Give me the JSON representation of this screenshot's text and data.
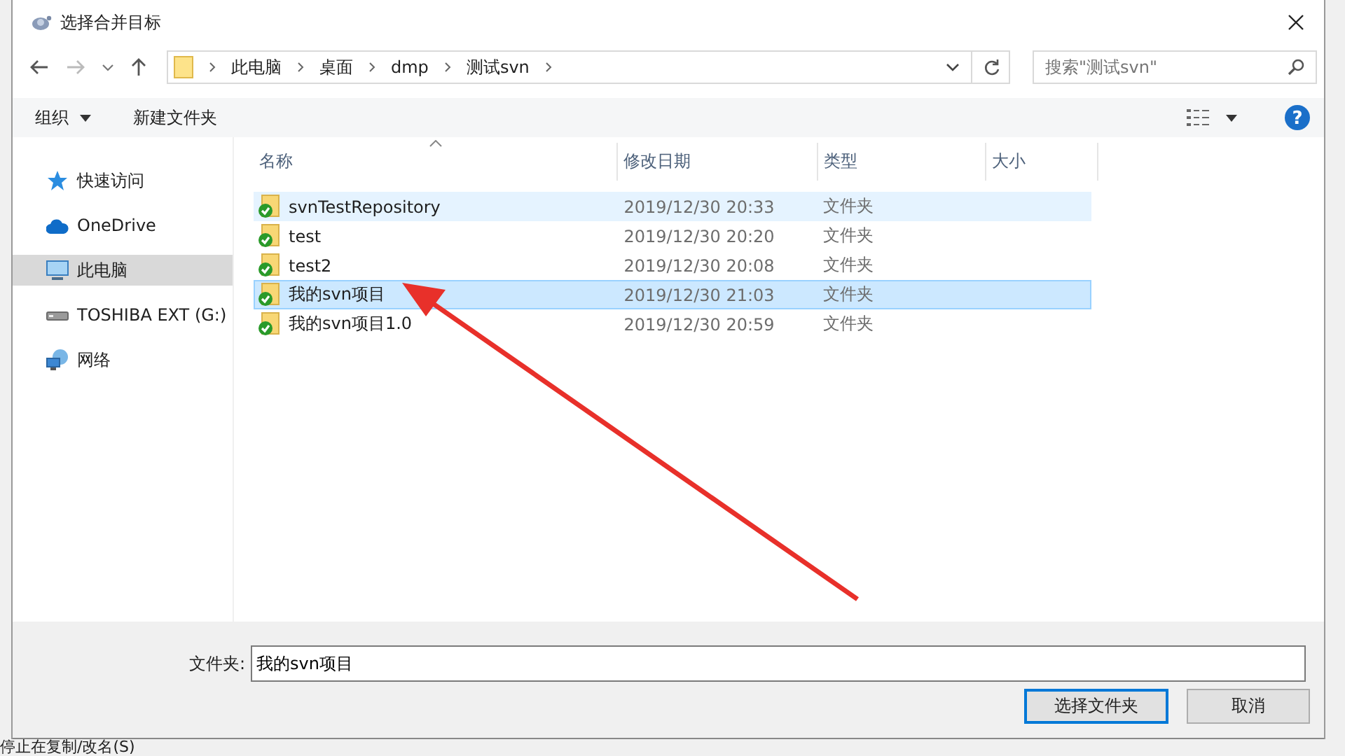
{
  "window": {
    "title": "选择合并目标"
  },
  "address_bar": {
    "path": [
      "此电脑",
      "桌面",
      "dmp",
      "测试svn"
    ]
  },
  "search": {
    "placeholder": "搜索\"测试svn\""
  },
  "toolbar": {
    "organize": "组织",
    "new_folder": "新建文件夹",
    "help": "?"
  },
  "nav": [
    {
      "label": "快速访问",
      "kind": "quick",
      "selected": false
    },
    {
      "label": "OneDrive",
      "kind": "cloud",
      "selected": false
    },
    {
      "label": "此电脑",
      "kind": "pc",
      "selected": true
    },
    {
      "label": "TOSHIBA EXT (G:)",
      "kind": "drive",
      "selected": false
    },
    {
      "label": "网络",
      "kind": "network",
      "selected": false
    }
  ],
  "columns": [
    {
      "label": "名称",
      "sorted": true
    },
    {
      "label": "修改日期",
      "sorted": false
    },
    {
      "label": "类型",
      "sorted": false
    },
    {
      "label": "大小",
      "sorted": false
    }
  ],
  "rows": [
    {
      "name": "svnTestRepository",
      "modified": "2019/12/30 20:33",
      "type": "文件夹",
      "selected": false,
      "hovered": true
    },
    {
      "name": "test",
      "modified": "2019/12/30 20:20",
      "type": "文件夹",
      "selected": false,
      "hovered": false
    },
    {
      "name": "test2",
      "modified": "2019/12/30 20:08",
      "type": "文件夹",
      "selected": false,
      "hovered": false
    },
    {
      "name": "我的svn项目",
      "modified": "2019/12/30 21:03",
      "type": "文件夹",
      "selected": true,
      "hovered": false
    },
    {
      "name": "我的svn项目1.0",
      "modified": "2019/12/30 20:59",
      "type": "文件夹",
      "selected": false,
      "hovered": false
    }
  ],
  "folder_field": {
    "label": "文件夹:",
    "value": "我的svn项目"
  },
  "buttons": [
    {
      "label": "选择文件夹",
      "kind": "primary"
    },
    {
      "label": "取消",
      "kind": "normal"
    }
  ],
  "background_window": {
    "status_text": "停止在复制/改名(S)"
  }
}
